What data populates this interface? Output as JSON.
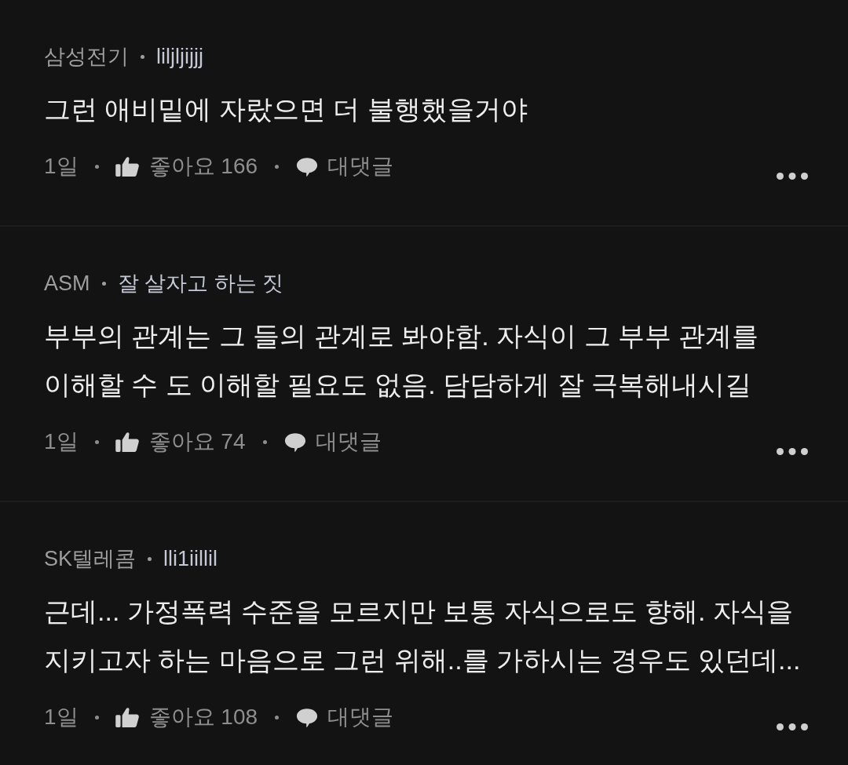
{
  "comments": [
    {
      "affiliation": "삼성전기",
      "nickname": "liljljijjj",
      "body": "그런 애비밑에 자랐으면 더 불행했을거야",
      "time": "1일",
      "like_button": "좋아요 166",
      "reply_button": "대댓글"
    },
    {
      "affiliation": "ASM",
      "nickname": "잘 살자고 하는 짓",
      "body": "부부의 관계는 그 들의 관계로 봐야함. 자식이 그 부부 관계를\n이해할 수 도 이해할 필요도 없음. 담담하게 잘 극복해내시길",
      "time": "1일",
      "like_button": "좋아요 74",
      "reply_button": "대댓글"
    },
    {
      "affiliation": "SK텔레콤",
      "nickname": "lli1iillil",
      "body": "근데... 가정폭력 수준을 모르지만 보통 자식으로도 향해. 자식을\n지키고자 하는 마음으로 그런 위해..를 가하시는 경우도 있던데...",
      "time": "1일",
      "like_button": "좋아요 108",
      "reply_button": "대댓글"
    }
  ]
}
